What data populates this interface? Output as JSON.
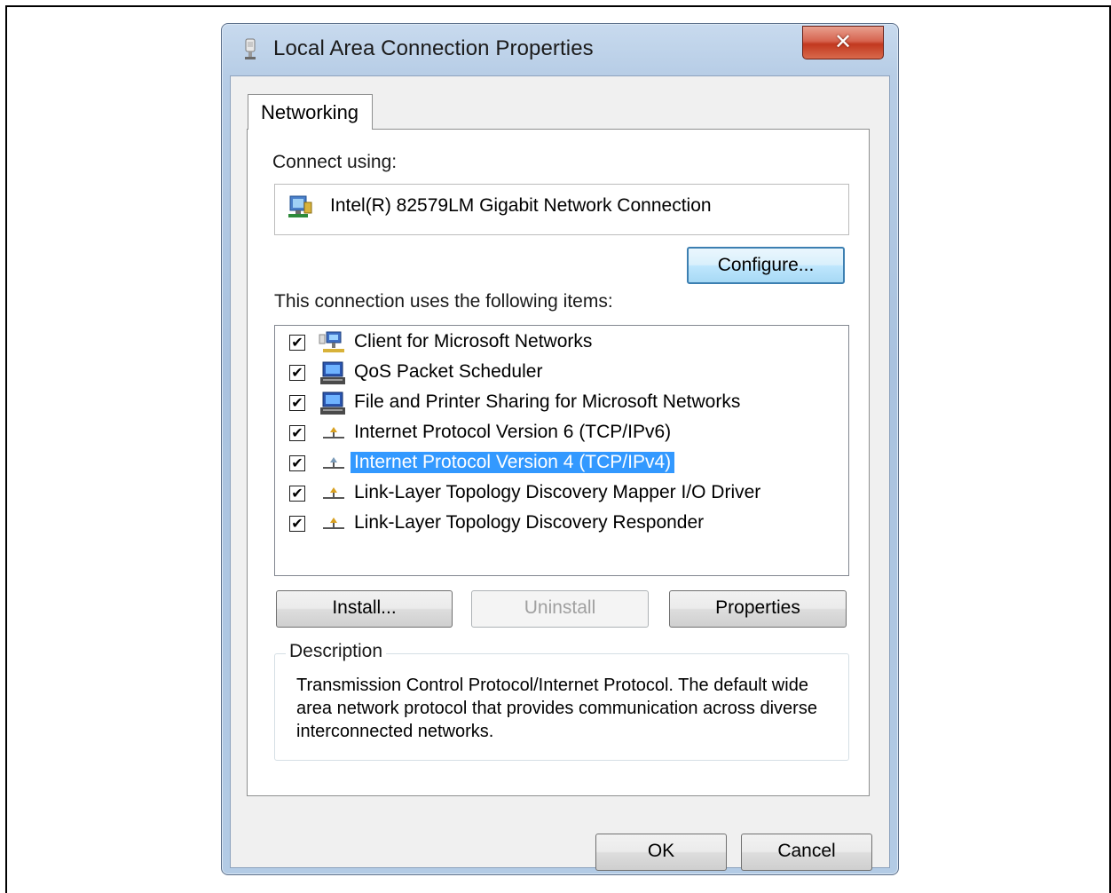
{
  "window": {
    "title": "Local Area Connection Properties",
    "close_glyph": "✕",
    "icon": "network-adapter-icon"
  },
  "tabs": [
    {
      "label": "Networking",
      "selected": true
    }
  ],
  "connect_using": {
    "label": "Connect using:",
    "adapter_name": "Intel(R) 82579LM Gigabit Network Connection",
    "adapter_icon": "network-card-icon"
  },
  "configure_button": "Configure...",
  "items_label": "This connection uses the following items:",
  "items": [
    {
      "label": "Client for Microsoft Networks",
      "checked": true,
      "icon": "client-network-icon",
      "selected": false
    },
    {
      "label": "QoS Packet Scheduler",
      "checked": true,
      "icon": "service-computer-icon",
      "selected": false
    },
    {
      "label": "File and Printer Sharing for Microsoft Networks",
      "checked": true,
      "icon": "service-computer-icon",
      "selected": false
    },
    {
      "label": "Internet Protocol Version 6 (TCP/IPv6)",
      "checked": true,
      "icon": "protocol-icon",
      "selected": false
    },
    {
      "label": "Internet Protocol Version 4 (TCP/IPv4)",
      "checked": true,
      "icon": "protocol-icon",
      "selected": true
    },
    {
      "label": "Link-Layer Topology Discovery Mapper I/O Driver",
      "checked": true,
      "icon": "protocol-icon",
      "selected": false
    },
    {
      "label": "Link-Layer Topology Discovery Responder",
      "checked": true,
      "icon": "protocol-icon",
      "selected": false
    }
  ],
  "checkmark": "✔",
  "buttons": {
    "install": "Install...",
    "uninstall": "Uninstall",
    "properties": "Properties",
    "ok": "OK",
    "cancel": "Cancel"
  },
  "description": {
    "title": "Description",
    "text": "Transmission Control Protocol/Internet Protocol. The default wide area network protocol that provides communication across diverse interconnected networks."
  },
  "colors": {
    "selection": "#3399ff",
    "close_button": "#c2381f",
    "focus_border": "#3c7fb1"
  }
}
